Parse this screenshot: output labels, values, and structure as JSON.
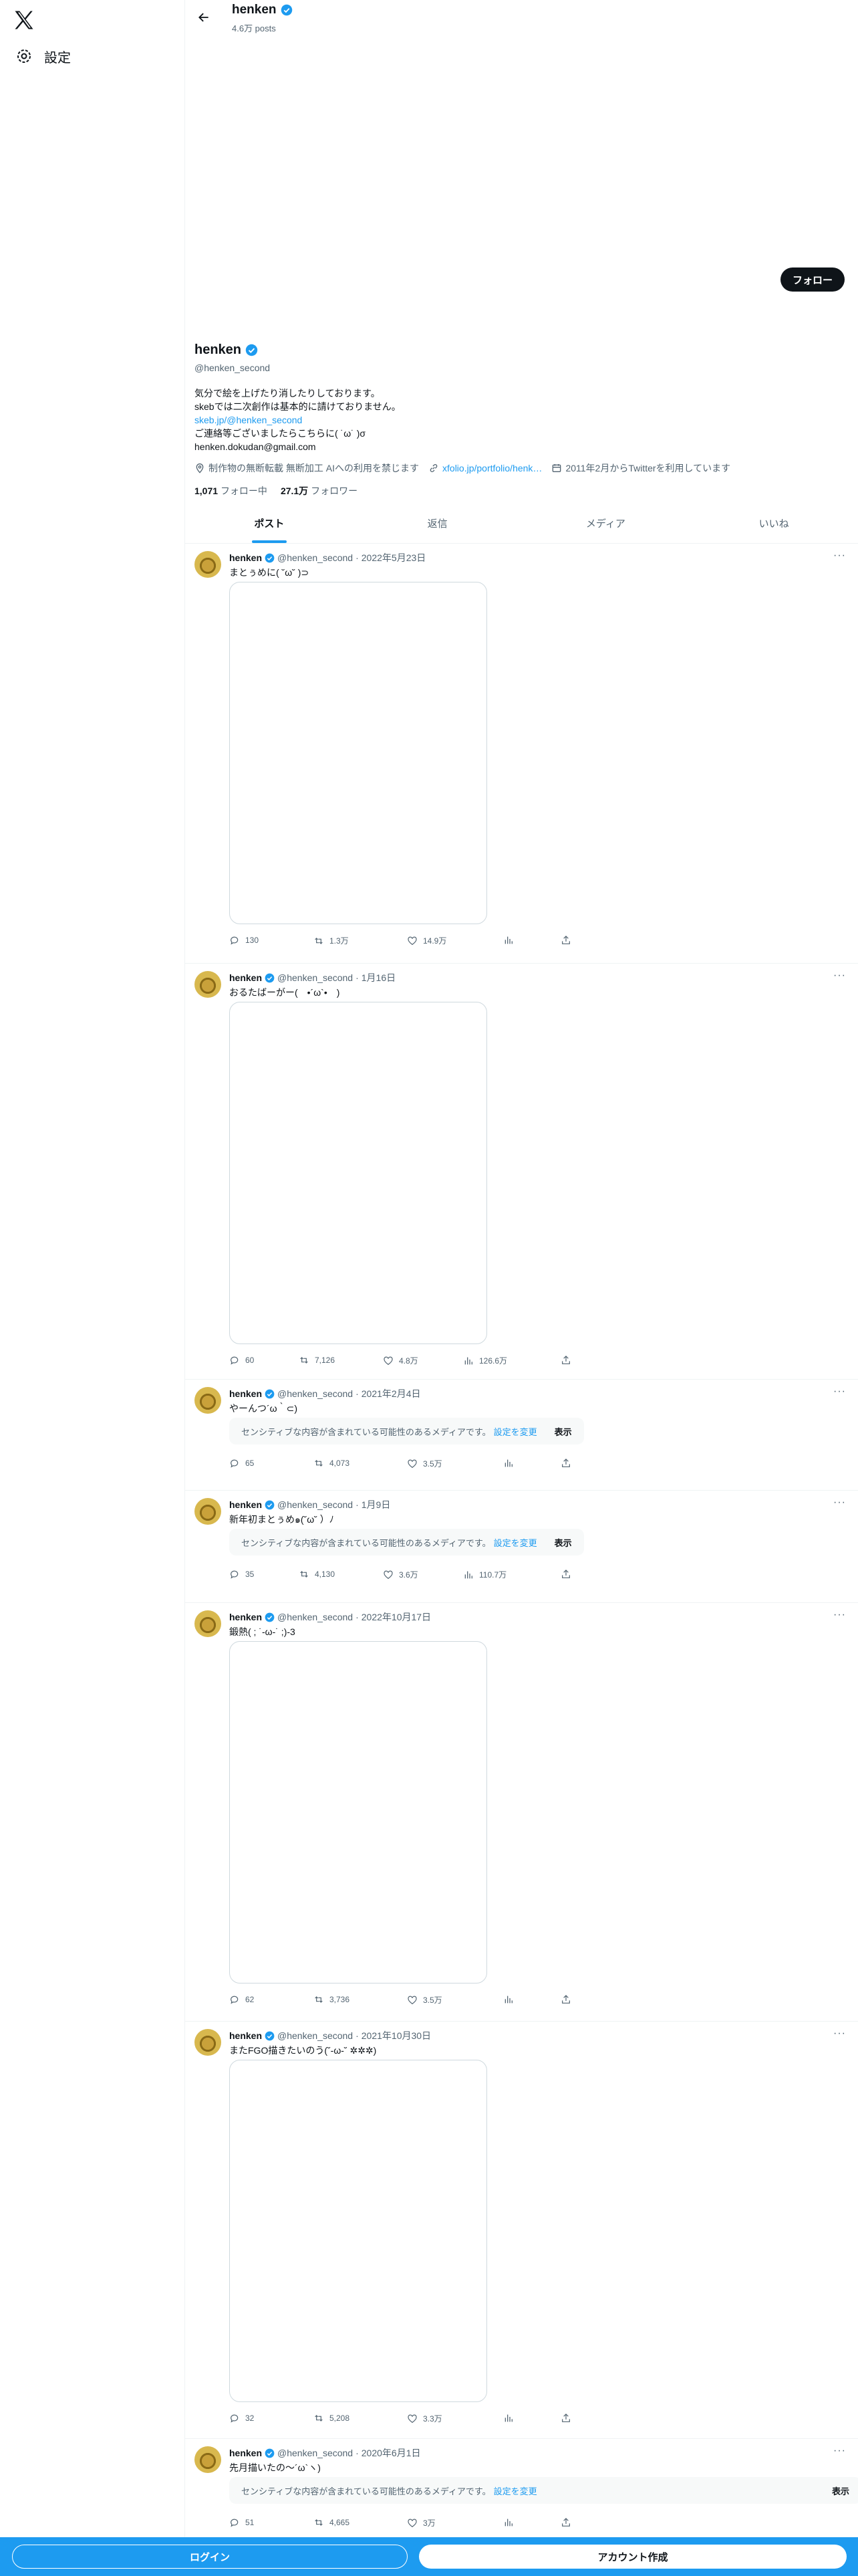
{
  "sidebar": {
    "settings_label": "設定"
  },
  "header": {
    "name": "henken",
    "posts": "4.6万 posts"
  },
  "profile": {
    "follow_label": "フォロー",
    "name": "henken",
    "handle": "@henken_second",
    "bio": [
      "気分で絵を上げたり消したりしております。",
      "skebでは二次創作は基本的に請けておりません。"
    ],
    "bio_link": "skeb.jp/@henken_second",
    "bio_contact": "ご連絡等ございましたらこちらに( ˙ω˙ )σ",
    "bio_email": "henken.dokudan@gmail.com",
    "location": "制作物の無断転載 無断加工 AIへの利用を禁じます",
    "website": "xfolio.jp/portfolio/henk…",
    "joined": "2011年2月からTwitterを利用しています",
    "following_count": "1,071",
    "following_label": "フォロー中",
    "followers_count": "27.1万",
    "followers_label": "フォロワー"
  },
  "tabs": [
    "ポスト",
    "返信",
    "メディア",
    "いいね"
  ],
  "tweets": [
    {
      "name": "henken",
      "handle": "@henken_second",
      "date": "2022年5月23日",
      "text": "まとぅめに( ˘ω˘ )⊃",
      "media": "image",
      "reply": "130",
      "repost": "1.3万",
      "like": "14.9万",
      "views": ""
    },
    {
      "name": "henken",
      "handle": "@henken_second",
      "date": "1月16日",
      "text": "おるたばーがー(　•´ω`•　)",
      "media": "image",
      "reply": "60",
      "repost": "7,126",
      "like": "4.8万",
      "views": "126.6万"
    },
    {
      "name": "henken",
      "handle": "@henken_second",
      "date": "2021年2月4日",
      "text": "やーんつ´ω｀⊂)",
      "media": "sensitive",
      "reply": "65",
      "repost": "4,073",
      "like": "3.5万",
      "views": ""
    },
    {
      "name": "henken",
      "handle": "@henken_second",
      "date": "1月9日",
      "text": "新年初まとぅめ๑(˘ω˘ ）ﾉ",
      "media": "sensitive",
      "reply": "35",
      "repost": "4,130",
      "like": "3.6万",
      "views": "110.7万"
    },
    {
      "name": "henken",
      "handle": "@henken_second",
      "date": "2022年10月17日",
      "text": "鍛熱( ; ˙-ω-˙ ;)-3",
      "media": "image",
      "reply": "62",
      "repost": "3,736",
      "like": "3.5万",
      "views": ""
    },
    {
      "name": "henken",
      "handle": "@henken_second",
      "date": "2021年10月30日",
      "text": "またFGO描きたいのう(˘-ω-˘ ✲✲✲)",
      "media": "image",
      "reply": "32",
      "repost": "5,208",
      "like": "3.3万",
      "views": ""
    },
    {
      "name": "henken",
      "handle": "@henken_second",
      "date": "2020年6月1日",
      "text": "先月描いたの〜´ω`ヽ)",
      "media": "sensitive",
      "reply": "51",
      "repost": "4,665",
      "like": "3万",
      "views": ""
    }
  ],
  "sensitive": {
    "message": "センシティブな内容が含まれている可能性のあるメディアです。",
    "change": "設定を変更",
    "show": "表示"
  },
  "bottom": {
    "login": "ログイン",
    "signup": "アカウント作成"
  }
}
